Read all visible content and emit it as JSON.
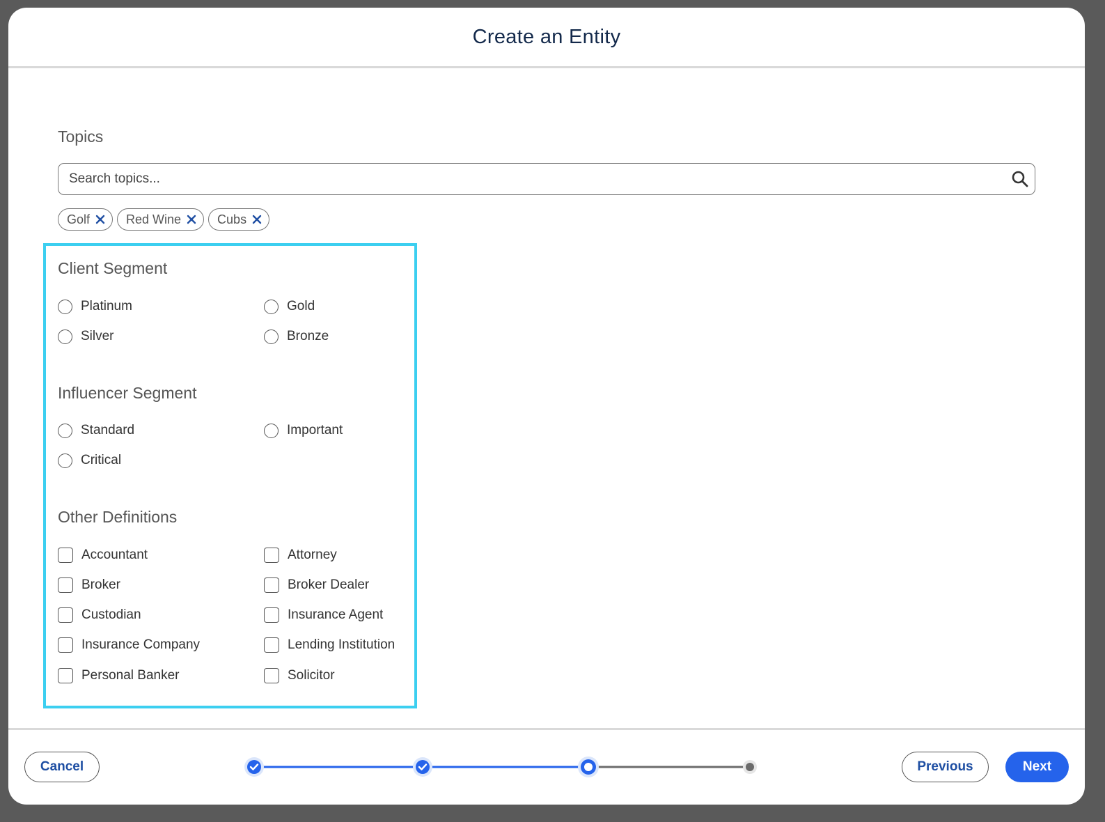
{
  "modal": {
    "title": "Create an Entity"
  },
  "topics": {
    "label": "Topics",
    "search_placeholder": "Search topics...",
    "chips": [
      "Golf",
      "Red Wine",
      "Cubs"
    ]
  },
  "client_segment": {
    "title": "Client Segment",
    "options": [
      "Platinum",
      "Gold",
      "Silver",
      "Bronze"
    ]
  },
  "influencer_segment": {
    "title": "Influencer Segment",
    "options": [
      "Standard",
      "Important",
      "Critical"
    ]
  },
  "other_definitions": {
    "title": "Other Definitions",
    "options": [
      "Accountant",
      "Attorney",
      "Broker",
      "Broker Dealer",
      "Custodian",
      "Insurance Agent",
      "Insurance Company",
      "Lending Institution",
      "Personal Banker",
      "Solicitor"
    ]
  },
  "footer": {
    "cancel_label": "Cancel",
    "previous_label": "Previous",
    "next_label": "Next",
    "steps": [
      "complete",
      "complete",
      "current",
      "upcoming"
    ]
  },
  "colors": {
    "accent": "#2563eb",
    "highlight": "#3ccff0",
    "title": "#13294b"
  }
}
